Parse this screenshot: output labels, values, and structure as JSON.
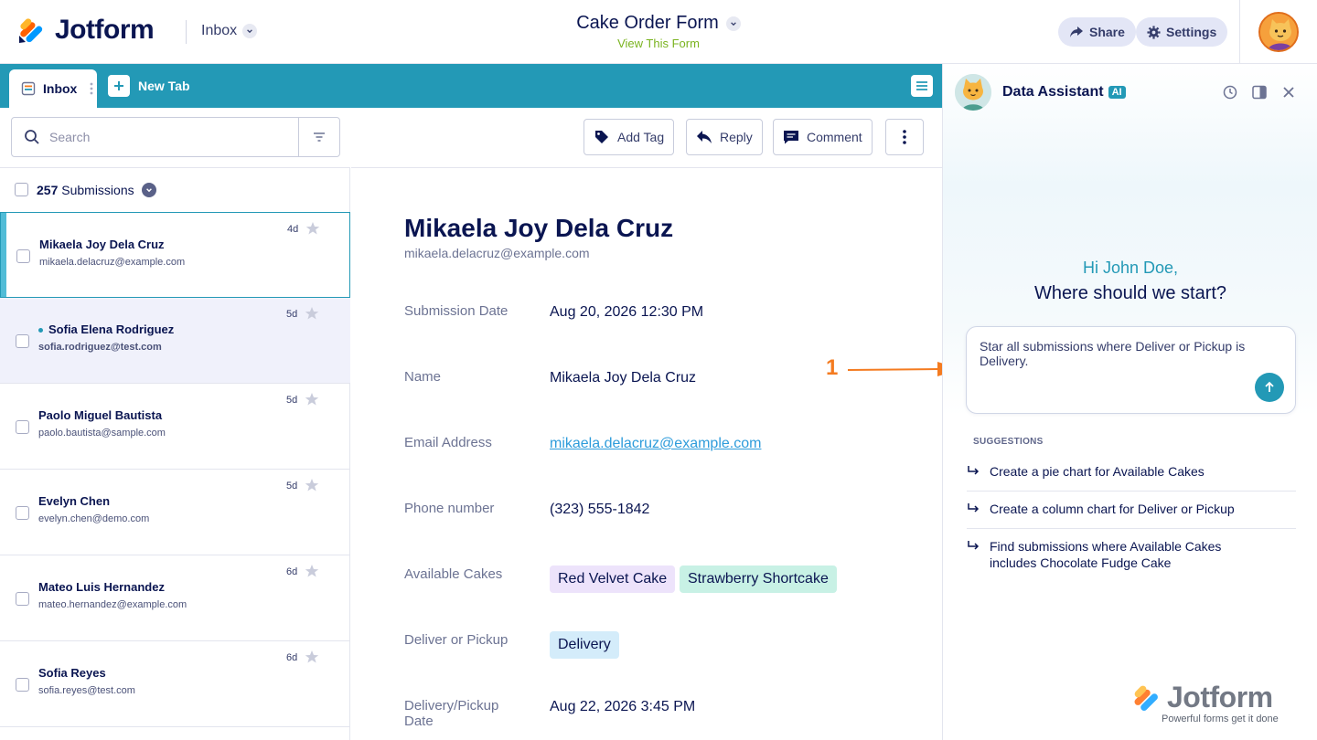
{
  "brand": {
    "name": "Jotform"
  },
  "header": {
    "inbox_label": "Inbox",
    "form_title": "Cake Order Form",
    "view_form": "View This Form",
    "share_label": "Share",
    "settings_label": "Settings"
  },
  "tabs": {
    "inbox": "Inbox",
    "new_tab": "New Tab"
  },
  "toolbar": {
    "search_placeholder": "Search",
    "add_tag": "Add Tag",
    "reply": "Reply",
    "comment": "Comment"
  },
  "list": {
    "count": "257",
    "count_label": "Submissions",
    "items": [
      {
        "name": "Mikaela Joy Dela Cruz",
        "email": "mikaela.delacruz@example.com",
        "age": "4d"
      },
      {
        "name": "Sofia Elena Rodriguez",
        "email": "sofia.rodriguez@test.com",
        "age": "5d"
      },
      {
        "name": "Paolo Miguel Bautista",
        "email": "paolo.bautista@sample.com",
        "age": "5d"
      },
      {
        "name": "Evelyn Chen",
        "email": "evelyn.chen@demo.com",
        "age": "5d"
      },
      {
        "name": "Mateo Luis Hernandez",
        "email": "mateo.hernandez@example.com",
        "age": "6d"
      },
      {
        "name": "Sofia Reyes",
        "email": "sofia.reyes@test.com",
        "age": "6d"
      }
    ]
  },
  "detail": {
    "name": "Mikaela Joy Dela Cruz",
    "email": "mikaela.delacruz@example.com",
    "fields": [
      {
        "label": "Submission Date",
        "value": "Aug 20, 2026 12:30 PM"
      },
      {
        "label": "Name",
        "value": "Mikaela Joy Dela Cruz"
      },
      {
        "label": "Email Address",
        "value": "mikaela.delacruz@example.com"
      },
      {
        "label": "Phone number",
        "value": "(323) 555-1842"
      },
      {
        "label": "Available Cakes",
        "chips": [
          "Red Velvet Cake",
          "Strawberry Shortcake"
        ]
      },
      {
        "label": "Deliver or Pickup",
        "chips": [
          "Delivery"
        ]
      },
      {
        "label": "Delivery/Pickup Date",
        "value": "Aug 22, 2026 3:45 PM"
      }
    ]
  },
  "assistant": {
    "title": "Data Assistant",
    "badge": "AI",
    "greeting": "Hi John Doe,",
    "question": "Where should we start?",
    "prompt": "Star all submissions where Deliver or Pickup is Delivery.",
    "suggestions_label": "SUGGESTIONS",
    "suggestions": [
      "Create a pie chart for Available Cakes",
      "Create a column chart for Deliver or Pickup",
      "Find submissions where Available Cakes includes Chocolate Fudge Cake"
    ],
    "watermark_brand": "Jotform",
    "watermark_tagline": "Powerful forms get it done"
  },
  "annotation": {
    "label": "1"
  },
  "colors": {
    "accent": "#2399b6",
    "brand_navy": "#0a1551",
    "annotation": "#f47b20",
    "chip_purple": "#ede3fb",
    "chip_teal": "#c8f1e5",
    "chip_blue": "#d4ecfa"
  },
  "icons": {
    "search": "search-icon",
    "filter": "filter-icon",
    "tag": "tag-icon",
    "reply": "reply-icon",
    "comment": "comment-icon",
    "more": "more-vertical-icon",
    "share": "share-icon",
    "settings": "gear-icon",
    "history": "history-icon",
    "panel": "panel-toggle-icon",
    "close": "close-icon",
    "send": "send-arrow-icon",
    "star": "star-icon"
  }
}
